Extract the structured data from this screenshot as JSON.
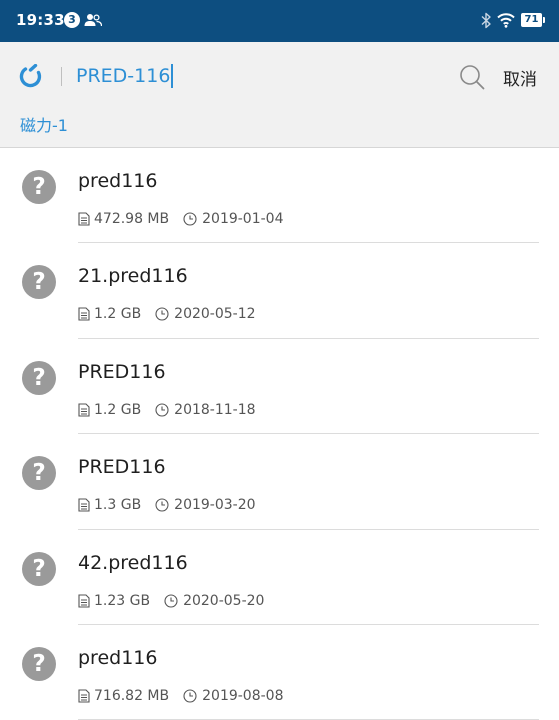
{
  "status_bar": {
    "time": "19:33",
    "notification_count": "3",
    "battery_level": "71",
    "icons": [
      "people-icon",
      "bluetooth-icon",
      "wifi-icon",
      "battery-icon"
    ]
  },
  "search": {
    "app_icon": "magnet-icon",
    "query": "PRED-116",
    "search_icon": "search-icon",
    "cancel_label": "取消",
    "source_tab": "磁力-1"
  },
  "colors": {
    "status_bar_bg": "#0d4e80",
    "accent": "#2d8fd5",
    "header_bg": "#f1f1f1",
    "icon_gray": "#9a9a9a"
  },
  "results": [
    {
      "title": "pred116",
      "size": "472.98 MB",
      "date": "2019-01-04"
    },
    {
      "title": "21.pred116",
      "size": "1.2 GB",
      "date": "2020-05-12"
    },
    {
      "title": "PRED116",
      "size": "1.2 GB",
      "date": "2018-11-18"
    },
    {
      "title": "PRED116",
      "size": "1.3 GB",
      "date": "2019-03-20"
    },
    {
      "title": "42.pred116",
      "size": "1.23 GB",
      "date": "2020-05-20"
    },
    {
      "title": "pred116",
      "size": "716.82 MB",
      "date": "2019-08-08"
    }
  ]
}
